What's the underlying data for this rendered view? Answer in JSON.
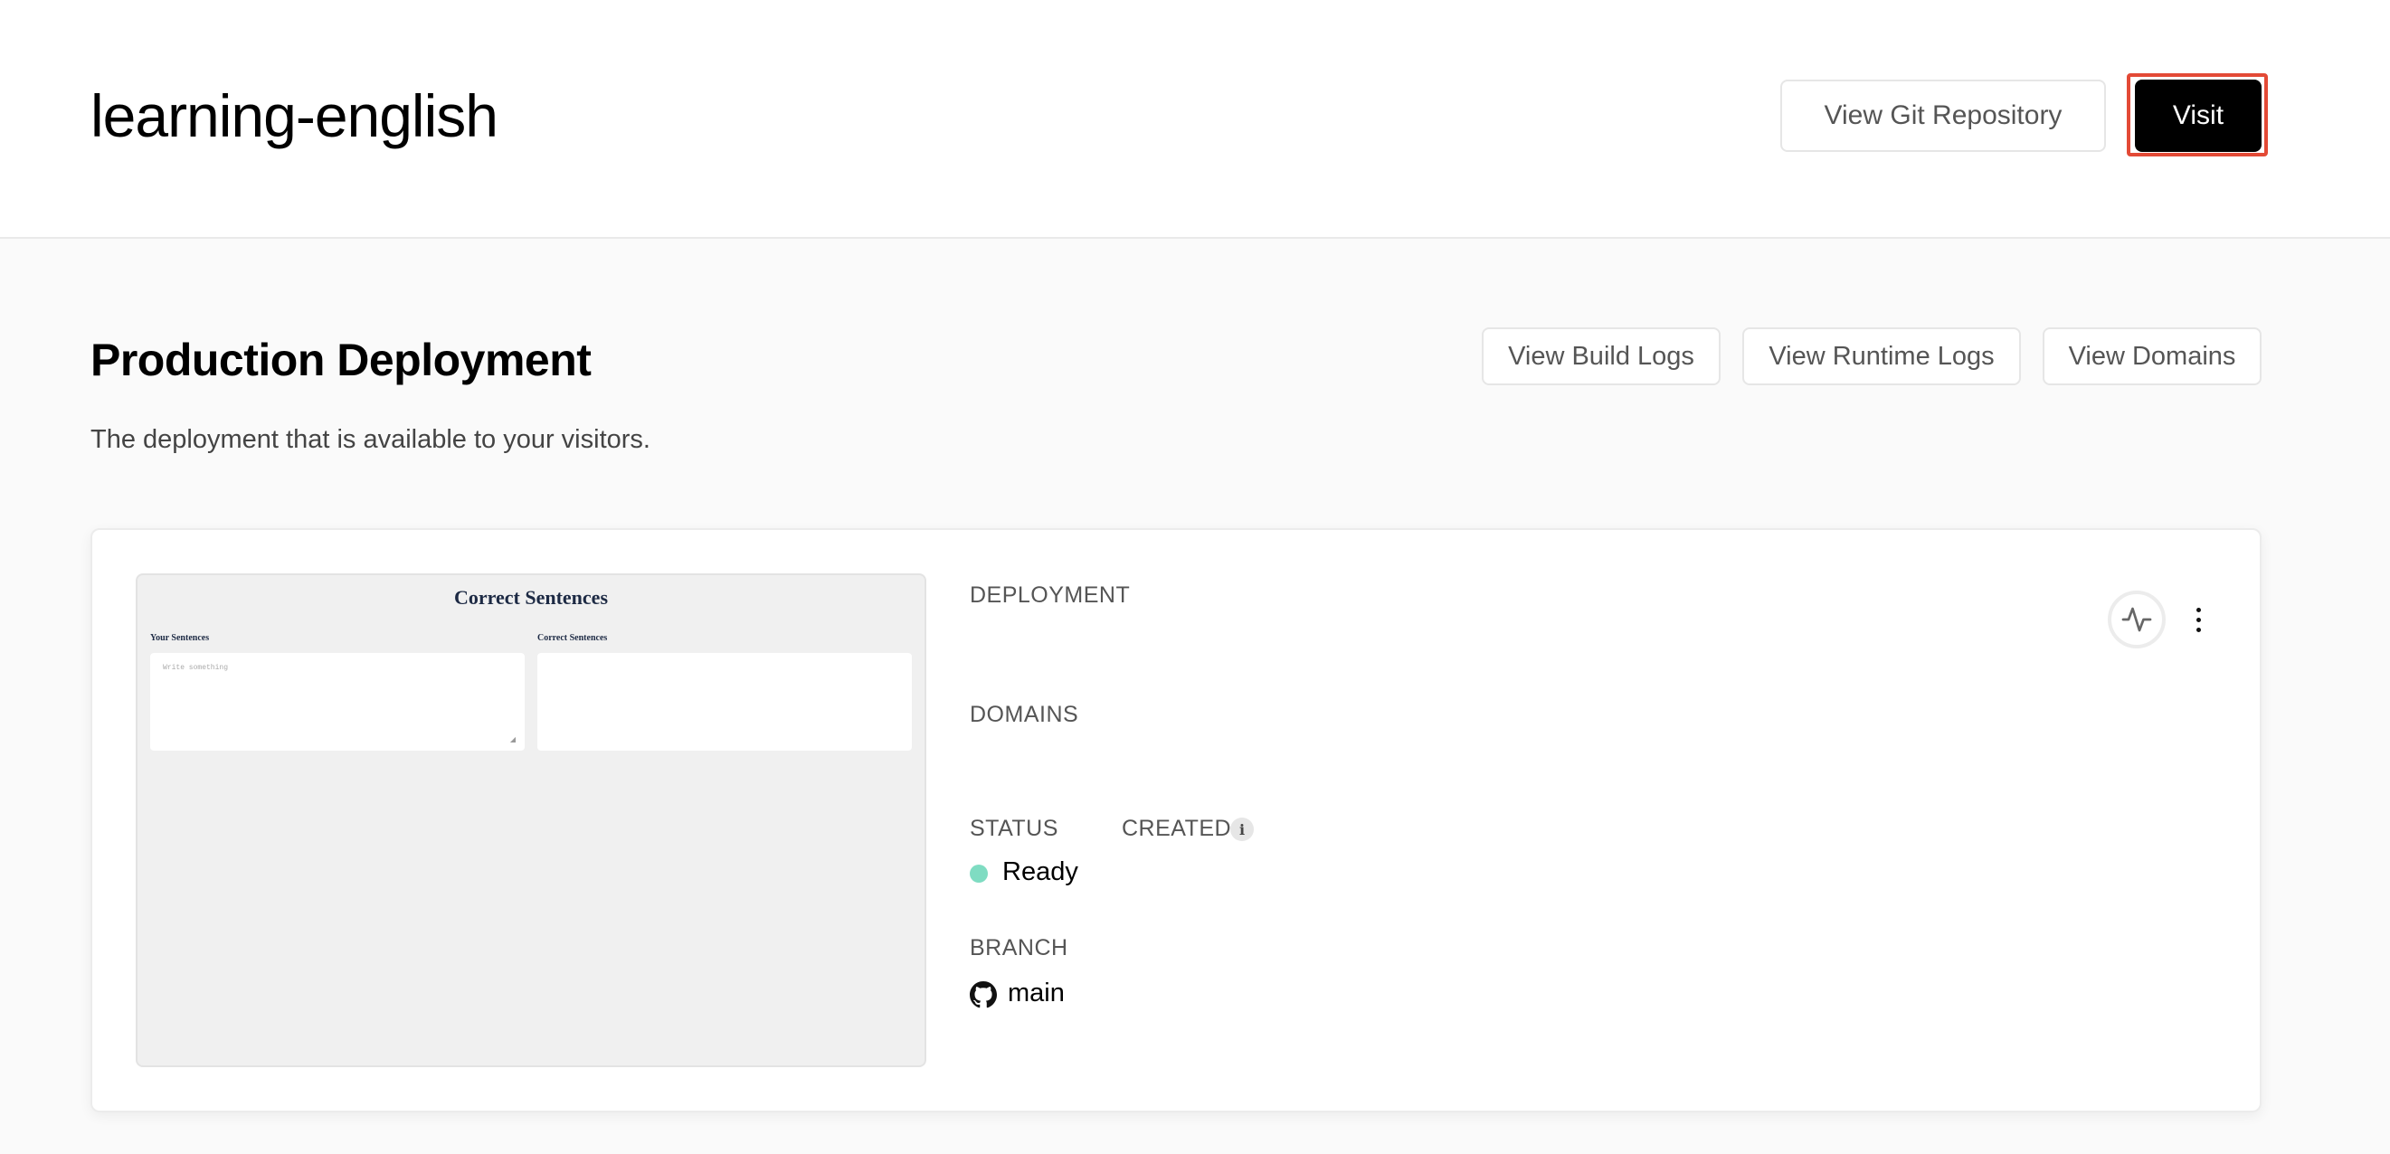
{
  "header": {
    "project_title": "learning-english",
    "git_button": "View Git Repository",
    "visit_button": "Visit"
  },
  "production": {
    "title": "Production Deployment",
    "description": "The deployment that is available to your visitors.",
    "buttons": {
      "build_logs": "View Build Logs",
      "runtime_logs": "View Runtime Logs",
      "domains": "View Domains"
    }
  },
  "preview": {
    "title": "Correct Sentences",
    "left_label": "Your Sentences",
    "right_label": "Correct Sentences",
    "placeholder": "Write something"
  },
  "details": {
    "deployment_label": "DEPLOYMENT",
    "domains_label": "DOMAINS",
    "status_label": "STATUS",
    "created_label": "CREATED",
    "status_value": "Ready",
    "branch_label": "BRANCH",
    "branch_value": "main"
  },
  "colors": {
    "status_ready": "#7fdcc2",
    "visit_highlight": "#e34a36",
    "visit_bg": "#000000"
  },
  "icons": {
    "info": "info-icon",
    "github": "github-icon",
    "activity": "activity-icon",
    "more": "more-vertical-icon"
  }
}
